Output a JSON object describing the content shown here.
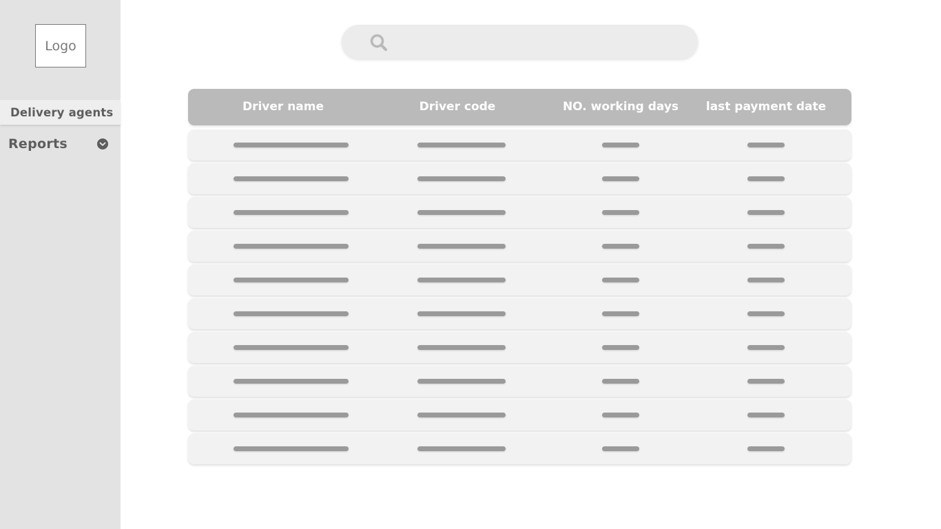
{
  "sidebar": {
    "logo_text": "Logo",
    "nav": {
      "active_label": "Delivery agents",
      "reports_label": "Reports"
    }
  },
  "search": {
    "placeholder": "",
    "value": ""
  },
  "table": {
    "headers": [
      "Driver name",
      "Driver code",
      "NO. working days",
      "last payment date"
    ],
    "row_count": 10
  },
  "colors": {
    "sidebar_bg": "#e3e3e3",
    "header_bg": "#bababa",
    "row_bg": "#f2f2f2",
    "placeholder_bar": "#9a9a9a"
  },
  "icons": {
    "search": "search-icon",
    "reports_toggle": "chevron-down-circle-icon"
  }
}
